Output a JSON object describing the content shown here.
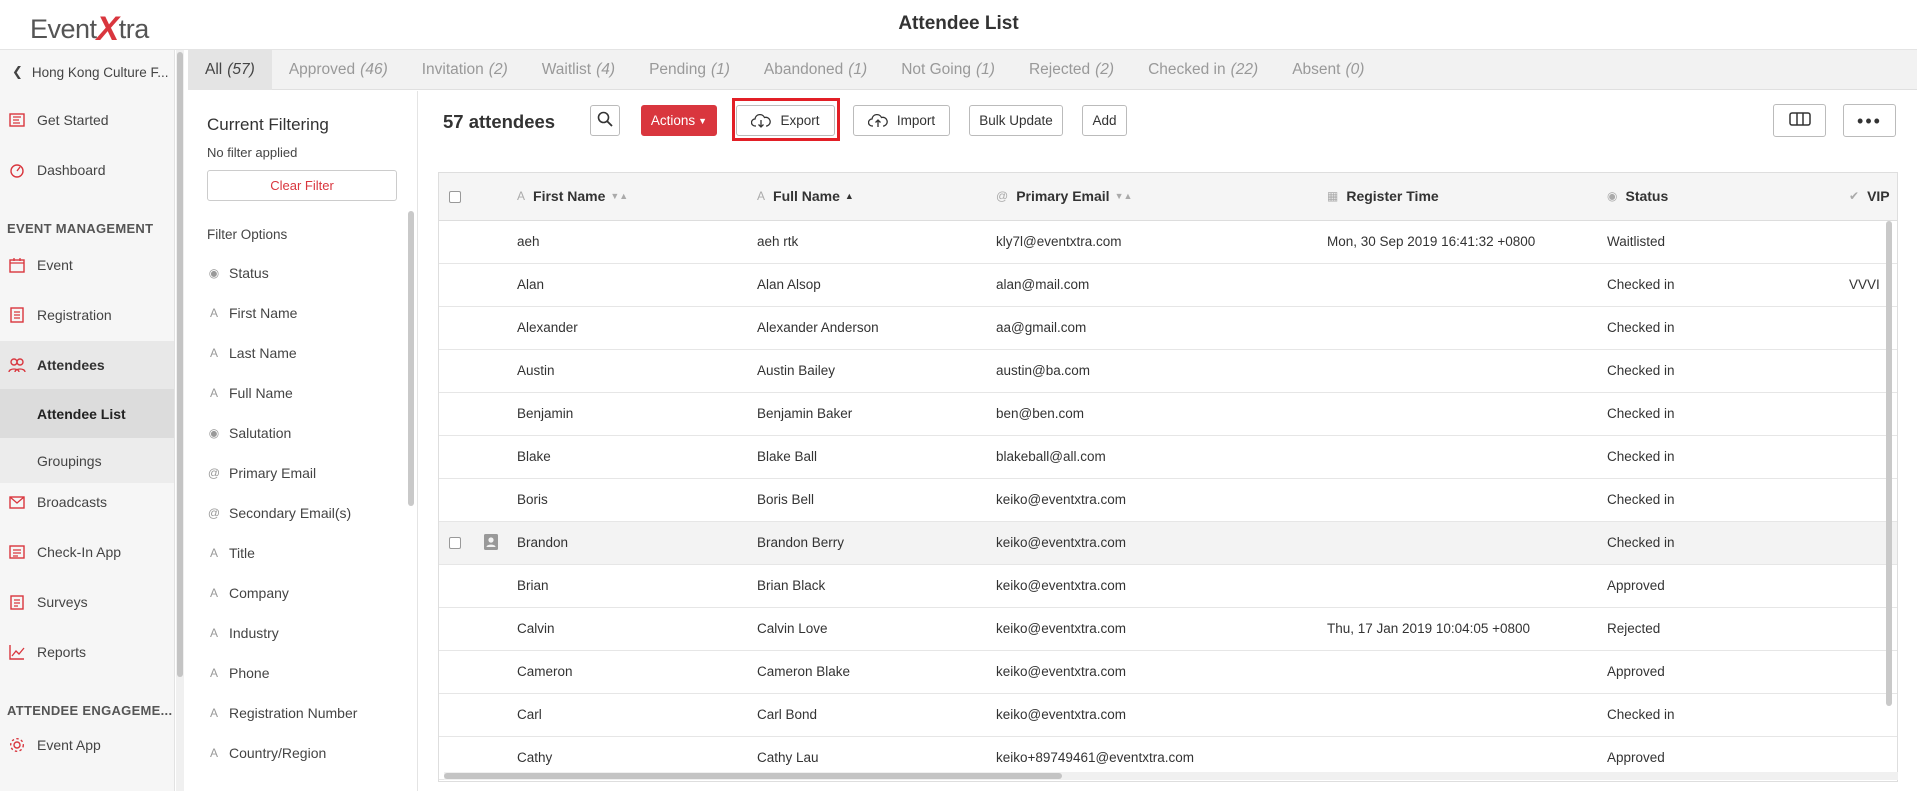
{
  "app": {
    "logo_left": "Event",
    "logo_x": "X",
    "logo_right": "tra",
    "page_title": "Attendee List"
  },
  "sidebar": {
    "back_label": "Hong Kong Culture F...",
    "items_top": [
      {
        "label": "Get Started",
        "icon": "flag-icon"
      },
      {
        "label": "Dashboard",
        "icon": "gauge-icon"
      }
    ],
    "section_event": "EVENT MANAGEMENT",
    "items_event": [
      {
        "label": "Event",
        "icon": "calendar-icon"
      },
      {
        "label": "Registration",
        "icon": "form-icon"
      },
      {
        "label": "Attendees",
        "icon": "people-icon"
      }
    ],
    "sub_items": [
      {
        "label": "Attendee List"
      },
      {
        "label": "Groupings"
      }
    ],
    "items_more": [
      {
        "label": "Broadcasts",
        "icon": "envelope-icon"
      },
      {
        "label": "Check-In App",
        "icon": "checkin-icon"
      },
      {
        "label": "Surveys",
        "icon": "clipboard-icon"
      },
      {
        "label": "Reports",
        "icon": "chart-icon"
      }
    ],
    "section_engagement": "ATTENDEE ENGAGEME...",
    "items_engagement": [
      {
        "label": "Event App",
        "icon": "cog-icon"
      }
    ]
  },
  "tabs": [
    {
      "label": "All",
      "count": "(57)"
    },
    {
      "label": "Approved",
      "count": "(46)"
    },
    {
      "label": "Invitation",
      "count": "(2)"
    },
    {
      "label": "Waitlist",
      "count": "(4)"
    },
    {
      "label": "Pending",
      "count": "(1)"
    },
    {
      "label": "Abandoned",
      "count": "(1)"
    },
    {
      "label": "Not Going",
      "count": "(1)"
    },
    {
      "label": "Rejected",
      "count": "(2)"
    },
    {
      "label": "Checked in",
      "count": "(22)"
    },
    {
      "label": "Absent",
      "count": "(0)"
    }
  ],
  "filter": {
    "title": "Current Filtering",
    "none": "No filter applied",
    "clear": "Clear Filter",
    "options_title": "Filter Options",
    "options": [
      {
        "label": "Status",
        "icon": "radio-icon"
      },
      {
        "label": "First Name",
        "icon": "text-icon"
      },
      {
        "label": "Last Name",
        "icon": "text-icon"
      },
      {
        "label": "Full Name",
        "icon": "text-icon"
      },
      {
        "label": "Salutation",
        "icon": "radio-icon"
      },
      {
        "label": "Primary Email",
        "icon": "at-icon"
      },
      {
        "label": "Secondary Email(s)",
        "icon": "at-icon"
      },
      {
        "label": "Title",
        "icon": "text-icon"
      },
      {
        "label": "Company",
        "icon": "text-icon"
      },
      {
        "label": "Industry",
        "icon": "text-icon"
      },
      {
        "label": "Phone",
        "icon": "text-icon"
      },
      {
        "label": "Registration Number",
        "icon": "text-icon"
      },
      {
        "label": "Country/Region",
        "icon": "text-icon"
      }
    ]
  },
  "toolbar": {
    "count": "57 attendees",
    "actions": "Actions",
    "export": "Export",
    "import": "Import",
    "bulk_update": "Bulk Update",
    "add": "Add"
  },
  "table": {
    "columns": [
      "First Name",
      "Full Name",
      "Primary Email",
      "Register Time",
      "Status",
      "VIP"
    ],
    "rows": [
      {
        "first": "aeh",
        "full": "aeh rtk",
        "email": "kly7l@eventxtra.com",
        "time": "Mon, 30 Sep 2019 16:41:32 +0800",
        "status": "Waitlisted",
        "vip": ""
      },
      {
        "first": "Alan",
        "full": "Alan Alsop",
        "email": "alan@mail.com",
        "time": "",
        "status": "Checked in",
        "vip": "VVVI"
      },
      {
        "first": "Alexander",
        "full": "Alexander  Anderson",
        "email": "aa@gmail.com",
        "time": "",
        "status": "Checked in",
        "vip": ""
      },
      {
        "first": "Austin",
        "full": "Austin Bailey",
        "email": "austin@ba.com",
        "time": "",
        "status": "Checked in",
        "vip": ""
      },
      {
        "first": "Benjamin",
        "full": "Benjamin  Baker",
        "email": "ben@ben.com",
        "time": "",
        "status": "Checked in",
        "vip": ""
      },
      {
        "first": "Blake",
        "full": "Blake Ball",
        "email": "blakeball@all.com",
        "time": "",
        "status": "Checked in",
        "vip": ""
      },
      {
        "first": "Boris",
        "full": "Boris  Bell",
        "email": "keiko@eventxtra.com",
        "time": "",
        "status": "Checked in",
        "vip": ""
      },
      {
        "first": "Brandon",
        "full": "Brandon  Berry",
        "email": "keiko@eventxtra.com",
        "time": "",
        "status": "Checked in",
        "vip": ""
      },
      {
        "first": "Brian",
        "full": "Brian  Black",
        "email": "keiko@eventxtra.com",
        "time": "",
        "status": "Approved",
        "vip": ""
      },
      {
        "first": "Calvin",
        "full": "Calvin Love",
        "email": "keiko@eventxtra.com",
        "time": "Thu, 17 Jan 2019 10:04:05 +0800",
        "status": "Rejected",
        "vip": ""
      },
      {
        "first": "Cameron",
        "full": "Cameron Blake",
        "email": "keiko@eventxtra.com",
        "time": "",
        "status": "Approved",
        "vip": ""
      },
      {
        "first": "Carl",
        "full": "Carl  Bond",
        "email": "keiko@eventxtra.com",
        "time": "",
        "status": "Checked in",
        "vip": ""
      },
      {
        "first": "Cathy",
        "full": "Cathy Lau",
        "email": "keiko+89749461@eventxtra.com",
        "time": "",
        "status": "Approved",
        "vip": ""
      }
    ]
  }
}
